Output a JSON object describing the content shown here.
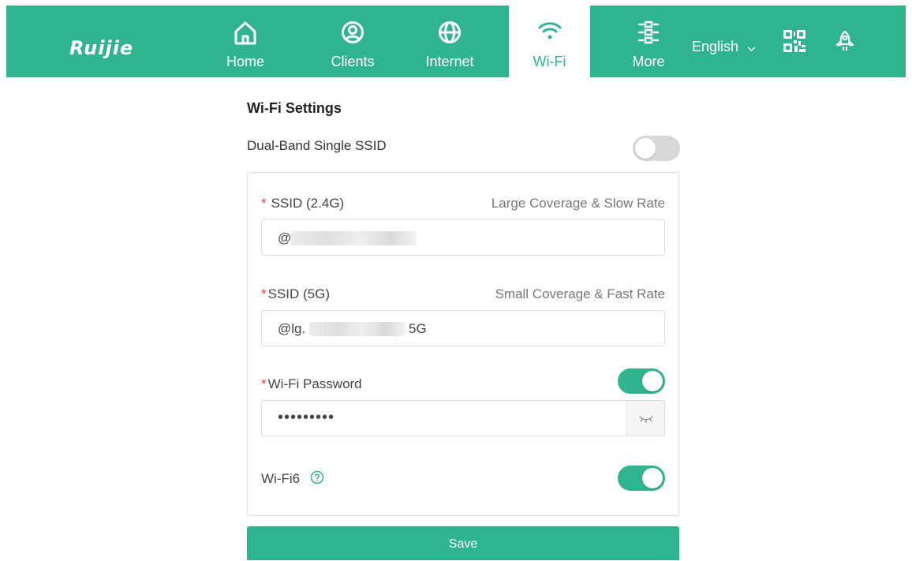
{
  "brand": {
    "logo_text": "Ruijie"
  },
  "nav": {
    "home": "Home",
    "clients": "Clients",
    "internet": "Internet",
    "wifi": "Wi-Fi",
    "more": "More",
    "active": "wifi"
  },
  "language": {
    "selected": "English"
  },
  "colors": {
    "accent": "#2fb48e",
    "required": "#e8413b",
    "toggle_off": "#d8d8d8"
  },
  "page": {
    "title": "Wi-Fi Settings",
    "dual_band": {
      "label": "Dual-Band Single SSID",
      "enabled": false
    }
  },
  "form": {
    "ssid_24": {
      "label": "SSID (2.4G)",
      "hint": "Large Coverage & Slow Rate",
      "value_prefix": "@"
    },
    "ssid_5": {
      "label": "SSID (5G)",
      "hint": "Small Coverage & Fast Rate",
      "value_prefix": "@lg.",
      "value_suffix": "5G"
    },
    "password": {
      "label": "Wi-Fi Password",
      "enabled": true,
      "masked_value": "•••••••••"
    },
    "wifi6": {
      "label": "Wi-Fi6",
      "enabled": true
    }
  },
  "icons": {
    "home": "home-icon",
    "clients": "user-circle-icon",
    "internet": "globe-icon",
    "wifi": "wifi-icon",
    "more": "sliders-icon",
    "qr": "qr-code-icon",
    "rocket": "rocket-icon",
    "eye": "eye-closed-icon",
    "help": "question-circle-icon"
  },
  "actions": {
    "save_label": "Save"
  }
}
